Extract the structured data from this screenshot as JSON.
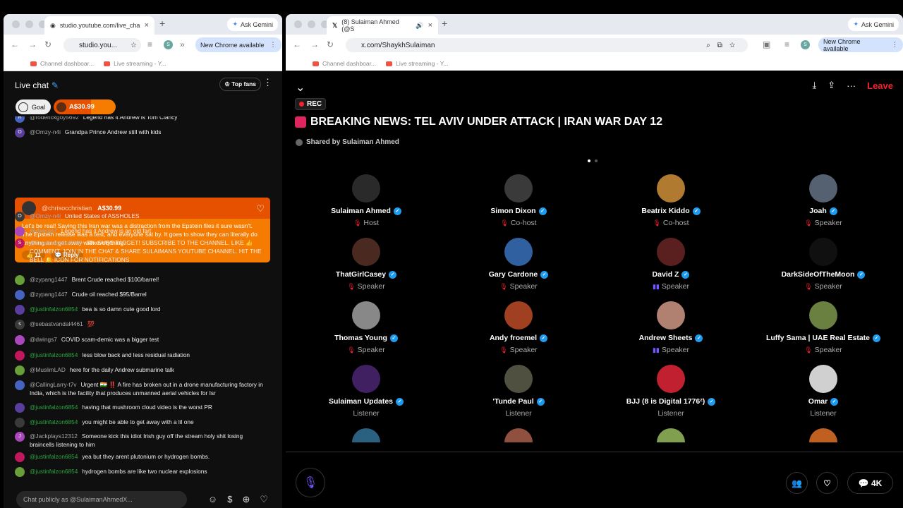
{
  "left_window": {
    "tab_title": "studio.youtube.com/live_cha",
    "url": "studio.you...",
    "ask_gemini": "Ask Gemini",
    "new_chrome": "New Chrome available",
    "bookmarks": [
      "Channel dashboar...",
      "Live streaming - Y..."
    ],
    "profile_initial": "S"
  },
  "chat": {
    "title": "Live chat",
    "top_fans": "Top fans",
    "goal": "Goal",
    "pinned_amount": "A$30.99",
    "messages": [
      {
        "initial": "R",
        "user": "@roderickgoy5692",
        "text": "Legend has it Andrew is Tom Clancy"
      },
      {
        "initial": "O",
        "user": "@Omzy-n4i",
        "text": "Grandpa Prince Andrew still with kids"
      },
      {
        "initial": "O",
        "user": "@Omzy-n4i",
        "text": "United States of ASSHOLES"
      },
      {
        "initial": "",
        "user": "@dwings7",
        "text": "Legend has it Andrew is an old fart"
      },
      {
        "initial": "S",
        "user": "@saadmandhu9700",
        "text": "50k SUBS TARGET! SUBSCRIBE TO THE CHANNEL. LIKE 👍 COMMENT, JOIN IN THE CHAT & SHARE SULAIMANS YOUTUBE CHANNEL. HIT THE BELL 🔔 ICON FOR NOTIFICATIONS"
      },
      {
        "initial": "",
        "user": "@zypang1447",
        "text": "Brent Crude reached $100/barrel!"
      },
      {
        "initial": "",
        "user": "@zypang1447",
        "text": "Crude oil reached $95/Barrel"
      },
      {
        "initial": "",
        "user": "@justinfalzon6854",
        "text": "bea is so damn cute good lord",
        "member": true
      },
      {
        "initial": "s",
        "user": "@sebastvandal4461",
        "text": "💯"
      },
      {
        "initial": "",
        "user": "@dwings7",
        "text": "COVID scam-demic was a bigger test"
      },
      {
        "initial": "",
        "user": "@justinfalzon6854",
        "text": "less blow back and less residual radiation",
        "member": true
      },
      {
        "initial": "",
        "user": "@MuslimLAD",
        "text": "here for the daily Andrew submarine talk"
      },
      {
        "initial": "",
        "user": "@CallingLarry-t7v",
        "text": "Urgent 🇮🇳 ‼️ A fire has broken out in a drone manufacturing factory in India, which is the facility that produces unmanned aerial vehicles for Isr"
      },
      {
        "initial": "",
        "user": "@justinfalzon6854",
        "text": "having that mushroom cloud video is the worst PR",
        "member": true
      },
      {
        "initial": "",
        "user": "@justinfalzon6854",
        "text": "you might be able to get away with a lil one",
        "member": true
      },
      {
        "initial": "J",
        "user": "@Jackplays12312",
        "text": "Someone kick this idiot Irish guy off the stream holy shit losing braincells listening to him"
      },
      {
        "initial": "",
        "user": "@justinfalzon6854",
        "text": "yea but they arent plutonium or hydrogen bombs.",
        "member": true
      },
      {
        "initial": "",
        "user": "@justinfalzon6854",
        "text": "hydrogen bombs are like two nuclear explosions",
        "member": true
      }
    ],
    "superchat": {
      "user": "@chrisocchristian",
      "amount": "A$30.99",
      "text": "Let's be real! Saying this Iran war was a distraction from the Epstein files it sure wasn't. The Epstein release was a test, and everyone sat by. It goes to show they can literally do anything and get away with everything.",
      "likes": "11",
      "reply": "Reply"
    },
    "input_placeholder": "Chat publicly as @SulaimanAhmedX..."
  },
  "right_window": {
    "tab_title": "(8) Sulaiman Ahmed (@S",
    "url": "x.com/ShaykhSulaiman",
    "ask_gemini": "Ask Gemini",
    "new_chrome": "New Chrome available",
    "bookmarks": [
      "Channel dashboar...",
      "Live streaming - Y..."
    ],
    "profile_initial": "S"
  },
  "space": {
    "leave": "Leave",
    "rec": "REC",
    "title": "BREAKING NEWS: TEL AVIV UNDER ATTACK | IRAN WAR DAY 12",
    "shared_by": "Shared by Sulaiman Ahmed",
    "participants": [
      {
        "name": "Sulaiman Ahmed",
        "role": "Host",
        "color": "#2a2a2a"
      },
      {
        "name": "Simon Dixon",
        "role": "Co-host",
        "color": "#3a3a3a"
      },
      {
        "name": "Beatrix Kiddo",
        "role": "Co-host",
        "color": "#b07a30"
      },
      {
        "name": "Joah",
        "role": "Speaker",
        "color": "#556070"
      },
      {
        "name": "ThatGirlCasey",
        "role": "Speaker",
        "color": "#4a2a20"
      },
      {
        "name": "Gary Cardone",
        "role": "Speaker",
        "color": "#3060a0"
      },
      {
        "name": "David Z",
        "role": "Speaker",
        "color": "#5a2020",
        "speaking": true
      },
      {
        "name": "DarkSideOfTheMoon",
        "role": "Speaker",
        "color": "#101010"
      },
      {
        "name": "Thomas Young",
        "role": "Speaker",
        "color": "#888888"
      },
      {
        "name": "Andy froemel",
        "role": "Speaker",
        "color": "#a04020"
      },
      {
        "name": "Andrew Sheets",
        "role": "Speaker",
        "color": "#b08070",
        "speaking": true
      },
      {
        "name": "Luffy Sama | UAE Real Estate",
        "role": "Speaker",
        "color": "#6a8040"
      },
      {
        "name": "Sulaiman Updates",
        "role": "Listener",
        "color": "#402060"
      },
      {
        "name": "'Tunde Paul",
        "role": "Listener",
        "color": "#505040"
      },
      {
        "name": "BJJ (8 is Digital 1776²)",
        "role": "Listener",
        "color": "#c02030"
      },
      {
        "name": "Omar",
        "role": "Listener",
        "color": "#d0d0d0"
      }
    ],
    "count_label": "4K"
  }
}
